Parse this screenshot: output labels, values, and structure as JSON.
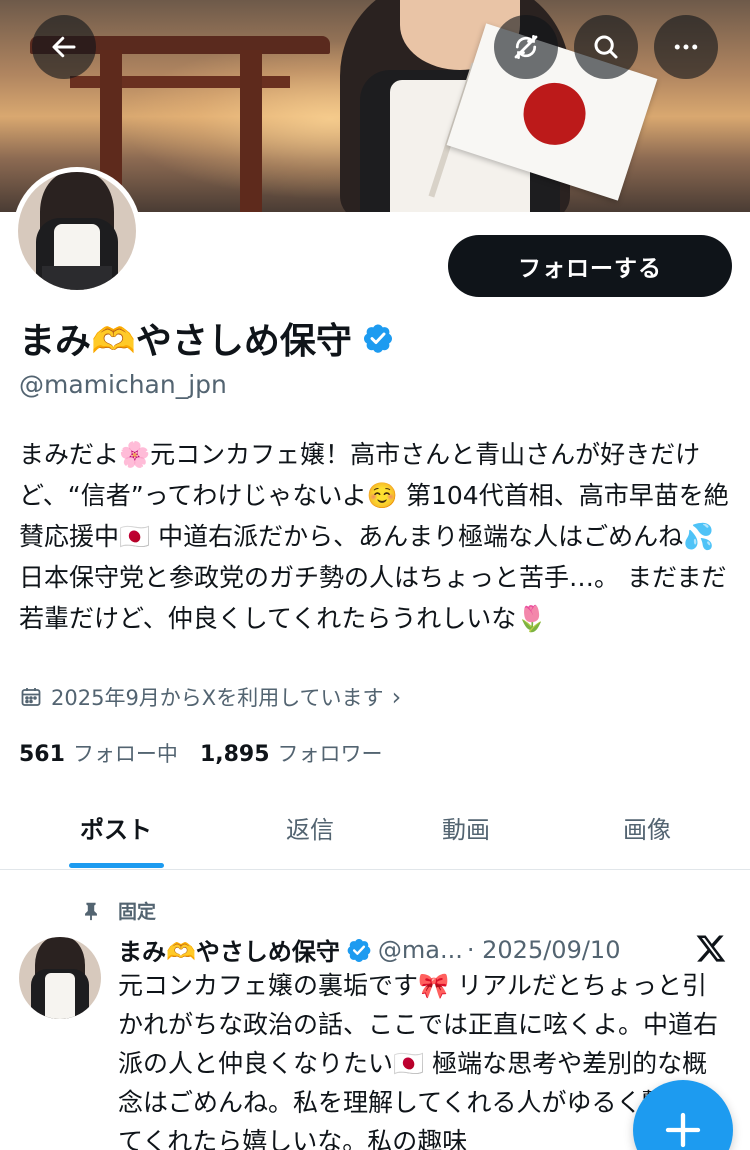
{
  "header": {
    "back_icon": "arrow-left-icon",
    "icons": [
      "no-sync-icon",
      "search-icon",
      "more-icon"
    ]
  },
  "profile": {
    "follow_button": "フォローする",
    "display_name": "まみ🫶やさしめ保守",
    "handle": "@mamichan_jpn",
    "bio": "まみだよ🌸元コンカフェ嬢！高市さんと青山さんが好きだけど、“信者”ってわけじゃないよ☺️ 第104代首相、高市早苗を絶賛応援中🇯🇵 中道右派だから、あんまり極端な人はごめんね💦 日本保守党と参政党のガチ勢の人はちょっと苦手…。 まだまだ若輩だけど、仲良くしてくれたらうれしいな🌷",
    "joined": "2025年9月からXを利用しています",
    "following_count": "561",
    "following_label": "フォロー中",
    "followers_count": "1,895",
    "followers_label": "フォロワー"
  },
  "tabs": [
    "ポスト",
    "返信",
    "動画",
    "画像"
  ],
  "pinned_post": {
    "pinned_label": "固定",
    "author_name": "まみ🫶やさしめ保守",
    "author_handle": "@ma...",
    "date": "· 2025/09/10",
    "text": "元コンカフェ嬢の裏垢です🎀 リアルだとちょっと引かれがちな政治の話、ここでは正直に呟くよ。中道右派の人と仲良くなりたい🇯🇵 極端な思考や差別的な概念はごめんね。私を理解してくれる人がゆるく繋がってくれたら嬉しいな。私の趣味"
  },
  "colors": {
    "accent": "#1d9bf0",
    "text_primary": "#0f1419",
    "text_secondary": "#536471",
    "follow_bg": "#0f1419"
  }
}
